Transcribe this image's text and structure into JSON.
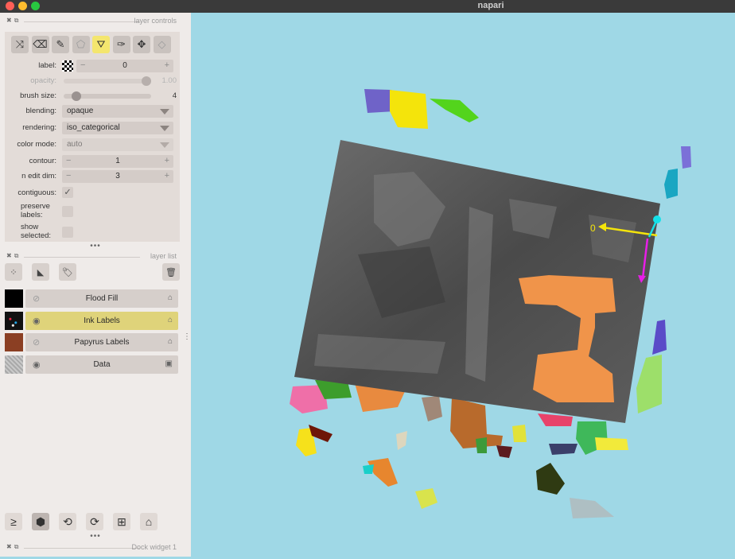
{
  "window": {
    "app_title": "napari"
  },
  "layer_controls": {
    "dock_title": "layer controls",
    "tools": [
      {
        "icon": "shuffle-icon",
        "glyph": "⤨"
      },
      {
        "icon": "eraser-icon",
        "glyph": "⌫"
      },
      {
        "icon": "paintbrush-icon",
        "glyph": "✎"
      },
      {
        "icon": "polygon-icon",
        "glyph": "⬠"
      },
      {
        "icon": "fill-bucket-icon",
        "glyph": "⛛"
      },
      {
        "icon": "color-picker-icon",
        "glyph": "✑"
      },
      {
        "icon": "pan-zoom-icon",
        "glyph": "✥"
      },
      {
        "icon": "transform-icon",
        "glyph": "◇"
      }
    ],
    "label": {
      "name": "label:",
      "value": "0",
      "minus": "−",
      "plus": "+"
    },
    "opacity": {
      "name": "opacity:",
      "value": "1.00",
      "level": 1.0
    },
    "brush_size": {
      "name": "brush size:",
      "value": "4",
      "level": 0.1
    },
    "blending": {
      "name": "blending:",
      "value": "opaque"
    },
    "rendering": {
      "name": "rendering:",
      "value": "iso_categorical"
    },
    "color_mode": {
      "name": "color mode:",
      "value": "auto"
    },
    "contour": {
      "name": "contour:",
      "value": "1",
      "minus": "−",
      "plus": "+"
    },
    "n_edit_dim": {
      "name": "n edit dim:",
      "value": "3",
      "minus": "−",
      "plus": "+"
    },
    "contiguous": {
      "name": "contiguous:",
      "checked": true,
      "mark": "✓"
    },
    "preserve_labels": {
      "name": "preserve labels:",
      "checked": false
    },
    "show_selected": {
      "name": "show selected:",
      "checked": false
    }
  },
  "layer_list": {
    "dock_title": "layer list",
    "buttons": [
      {
        "icon": "new-points-icon",
        "glyph": "⁘"
      },
      {
        "icon": "new-shapes-icon",
        "glyph": "◣"
      },
      {
        "icon": "new-labels-icon",
        "glyph": "🏷"
      },
      {
        "icon": "delete-layer-icon",
        "glyph": "🗑"
      }
    ],
    "layers": [
      {
        "name": "Flood Fill",
        "visible": false,
        "selected": false,
        "thumb_color": "#000000",
        "type_icon": "labels-type-icon",
        "type_glyph": "⌂"
      },
      {
        "name": "Ink Labels",
        "visible": true,
        "selected": true,
        "thumb_color": "#111111",
        "type_icon": "labels-type-icon",
        "type_glyph": "⌂"
      },
      {
        "name": "Papyrus Labels",
        "visible": false,
        "selected": false,
        "thumb_color": "#8b3f23",
        "type_icon": "labels-type-icon",
        "type_glyph": "⌂"
      },
      {
        "name": "Data",
        "visible": true,
        "selected": false,
        "thumb_color": "#b8b8b8",
        "type_icon": "image-type-icon",
        "type_glyph": "▣"
      }
    ]
  },
  "viewer_buttons": [
    {
      "icon": "console-icon",
      "glyph": "≥",
      "active": false
    },
    {
      "icon": "ndisplay-3d-icon",
      "glyph": "⬢",
      "active": true
    },
    {
      "icon": "roll-axes-icon",
      "glyph": "⟲",
      "active": false
    },
    {
      "icon": "transpose-icon",
      "glyph": "⟳",
      "active": false
    },
    {
      "icon": "grid-icon",
      "glyph": "⊞",
      "active": false
    },
    {
      "icon": "home-icon",
      "glyph": "⌂",
      "active": false
    }
  ],
  "dock_widget": {
    "title": "Dock widget 1"
  },
  "canvas": {
    "background": "#9fd8e6",
    "axis_label": "0",
    "accent_colors": {
      "orange": "#f0944a",
      "yellow": "#f4e40b",
      "magenta": "#e91ee8",
      "cyan": "#14e1e8"
    }
  }
}
